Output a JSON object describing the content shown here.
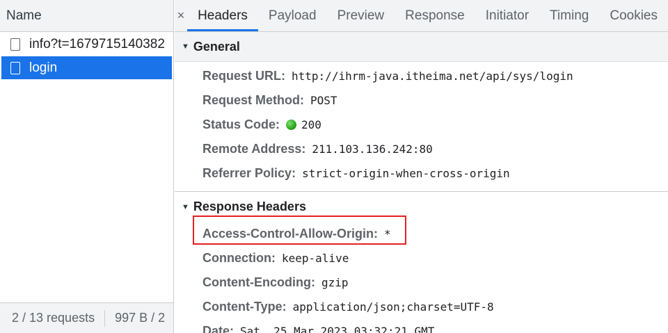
{
  "left": {
    "header": "Name",
    "requests": [
      {
        "name": "info?t=1679715140382",
        "selected": false
      },
      {
        "name": "login",
        "selected": true
      }
    ],
    "footer": {
      "requests_count": "2 / 13 requests",
      "size": "997 B / 2"
    }
  },
  "tabs": {
    "close_label": "×",
    "items": [
      "Headers",
      "Payload",
      "Preview",
      "Response",
      "Initiator",
      "Timing",
      "Cookies"
    ],
    "active": "Headers"
  },
  "general": {
    "title": "General",
    "rows": [
      {
        "key": "Request URL:",
        "value": "http://ihrm-java.itheima.net/api/sys/login"
      },
      {
        "key": "Request Method:",
        "value": "POST"
      },
      {
        "key": "Status Code:",
        "value": "200"
      },
      {
        "key": "Remote Address:",
        "value": "211.103.136.242:80"
      },
      {
        "key": "Referrer Policy:",
        "value": "strict-origin-when-cross-origin"
      }
    ]
  },
  "response_headers": {
    "title": "Response Headers",
    "rows": [
      {
        "key": "Access-Control-Allow-Origin:",
        "value": "*"
      },
      {
        "key": "Connection:",
        "value": "keep-alive"
      },
      {
        "key": "Content-Encoding:",
        "value": "gzip"
      },
      {
        "key": "Content-Type:",
        "value": "application/json;charset=UTF-8"
      },
      {
        "key": "Date:",
        "value": "Sat, 25 Mar 2023 03:32:21 GMT"
      }
    ]
  },
  "colors": {
    "accent": "#1a73e8",
    "status_ok": "#1f9a14",
    "highlight_border": "#e02020"
  },
  "icons": {
    "file": "file-icon",
    "collapse": "triangle-down-icon",
    "status": "status-dot-icon",
    "close": "close-icon"
  }
}
